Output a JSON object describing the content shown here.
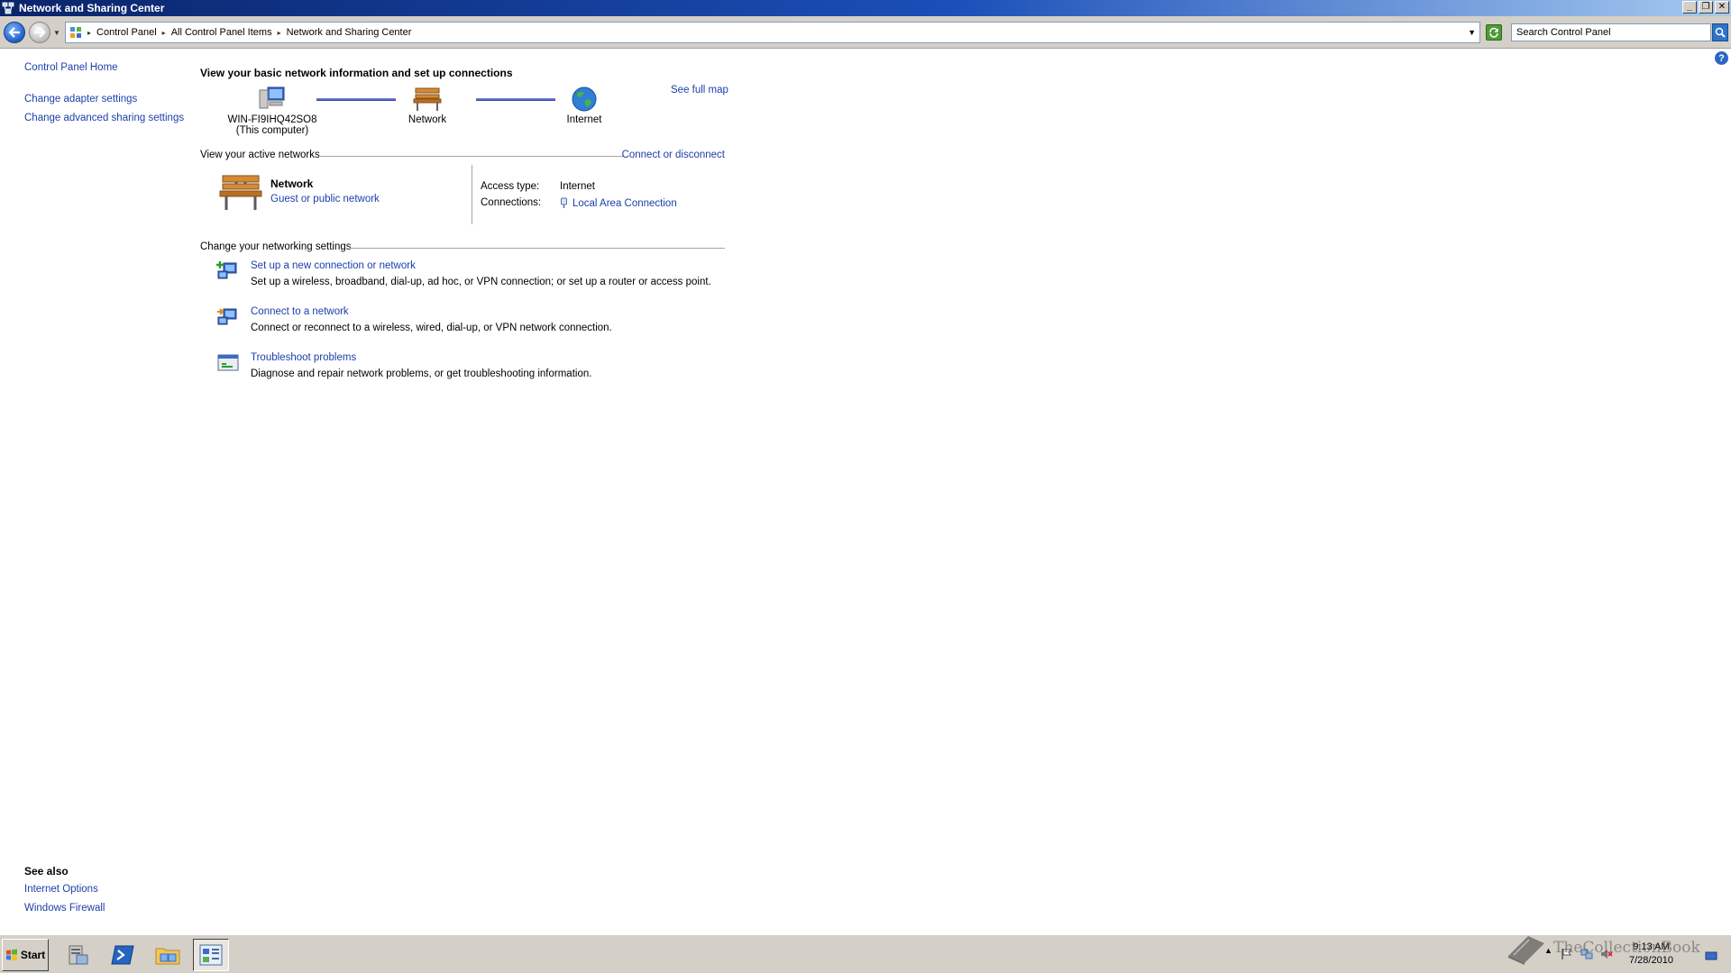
{
  "window": {
    "title": "Network and Sharing Center"
  },
  "address": {
    "crumbs": [
      "Control Panel",
      "All Control Panel Items",
      "Network and Sharing Center"
    ],
    "search_placeholder": "Search Control Panel"
  },
  "left_pane": {
    "links": [
      "Control Panel Home",
      "Change adapter settings",
      "Change advanced sharing settings"
    ]
  },
  "see_also": {
    "heading": "See also",
    "links": [
      "Internet Options",
      "Windows Firewall"
    ]
  },
  "main": {
    "heading": "View your basic network information and set up connections",
    "see_full_map": "See full map",
    "map": {
      "computer_name": "WIN-FI9IHQ42SO8",
      "computer_sub": "(This computer)",
      "network": "Network",
      "internet": "Internet"
    },
    "active_networks": {
      "title": "View your active networks",
      "connect_link": "Connect or disconnect",
      "network_name": "Network",
      "network_type": "Guest or public network",
      "access_label": "Access type:",
      "access_value": "Internet",
      "connections_label": "Connections:",
      "connections_value": "Local Area Connection"
    },
    "settings": {
      "title": "Change your networking settings",
      "tasks": [
        {
          "link": "Set up a new connection or network",
          "desc": "Set up a wireless, broadband, dial-up, ad hoc, or VPN connection; or set up a router or access point."
        },
        {
          "link": "Connect to a network",
          "desc": "Connect or reconnect to a wireless, wired, dial-up, or VPN network connection."
        },
        {
          "link": "Troubleshoot problems",
          "desc": "Diagnose and repair network problems, or get troubleshooting information."
        }
      ]
    }
  },
  "taskbar": {
    "start_label": "Start",
    "time": "9:13 AM",
    "date": "7/28/2010",
    "icons": [
      "server-manager-icon",
      "powershell-icon",
      "explorer-icon",
      "control-panel-icon"
    ]
  },
  "watermark": "TheCollectionBook",
  "colors": {
    "link": "#1b3fa8",
    "title_bar": "#0a246a",
    "taskbar": "#d4d0c8"
  }
}
